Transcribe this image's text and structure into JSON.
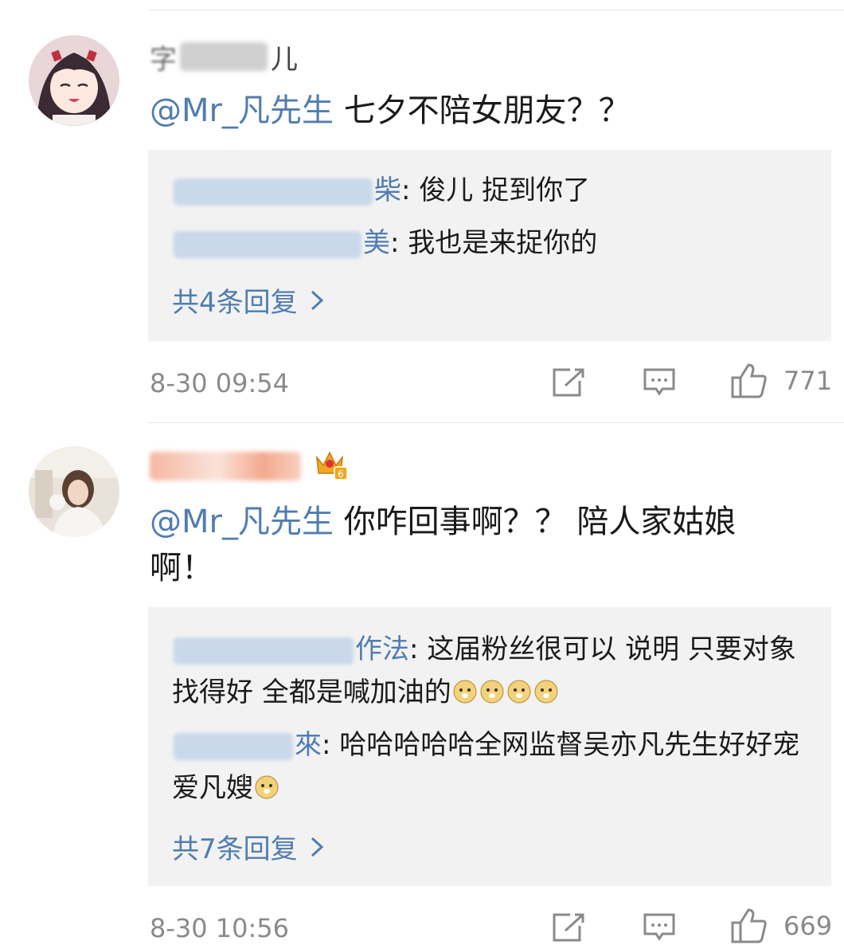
{
  "comments": [
    {
      "username_visible": "儿",
      "mention": "@Mr_凡先生",
      "text": "七夕不陪女朋友？？",
      "replies": [
        {
          "name_tail": "柴",
          "text": ": 俊儿 捉到你了"
        },
        {
          "name_tail": "美",
          "text": ": 我也是来捉你的"
        }
      ],
      "more_label": "共4条回复",
      "time": "8-30 09:54",
      "likes": "771"
    },
    {
      "mention": "@Mr_凡先生",
      "text": "你咋回事啊？？ 陪人家姑娘啊！",
      "replies": [
        {
          "name_tail": "作法",
          "text": ": 这届粉丝很可以 说明 只要对象找得好 全都是喊加油的"
        },
        {
          "name_tail": "來",
          "text": ": 哈哈哈哈哈全网监督吴亦凡先生好好宠爱凡嫂"
        }
      ],
      "more_label": "共7条回复",
      "time": "8-30 10:56",
      "likes": "669",
      "badge_level": "6"
    }
  ],
  "icons": {
    "repost": "repost-icon",
    "comment": "comment-icon",
    "like": "like-icon",
    "more": "chevron-right-icon",
    "emoji": "doge-emoji-icon",
    "badge": "crown-badge-icon"
  },
  "colors": {
    "link": "#507daf",
    "text": "#1a1a1a",
    "meta": "#8a8a8a",
    "reply_bg": "#f2f2f2",
    "badge_gold": "#f0a820"
  }
}
